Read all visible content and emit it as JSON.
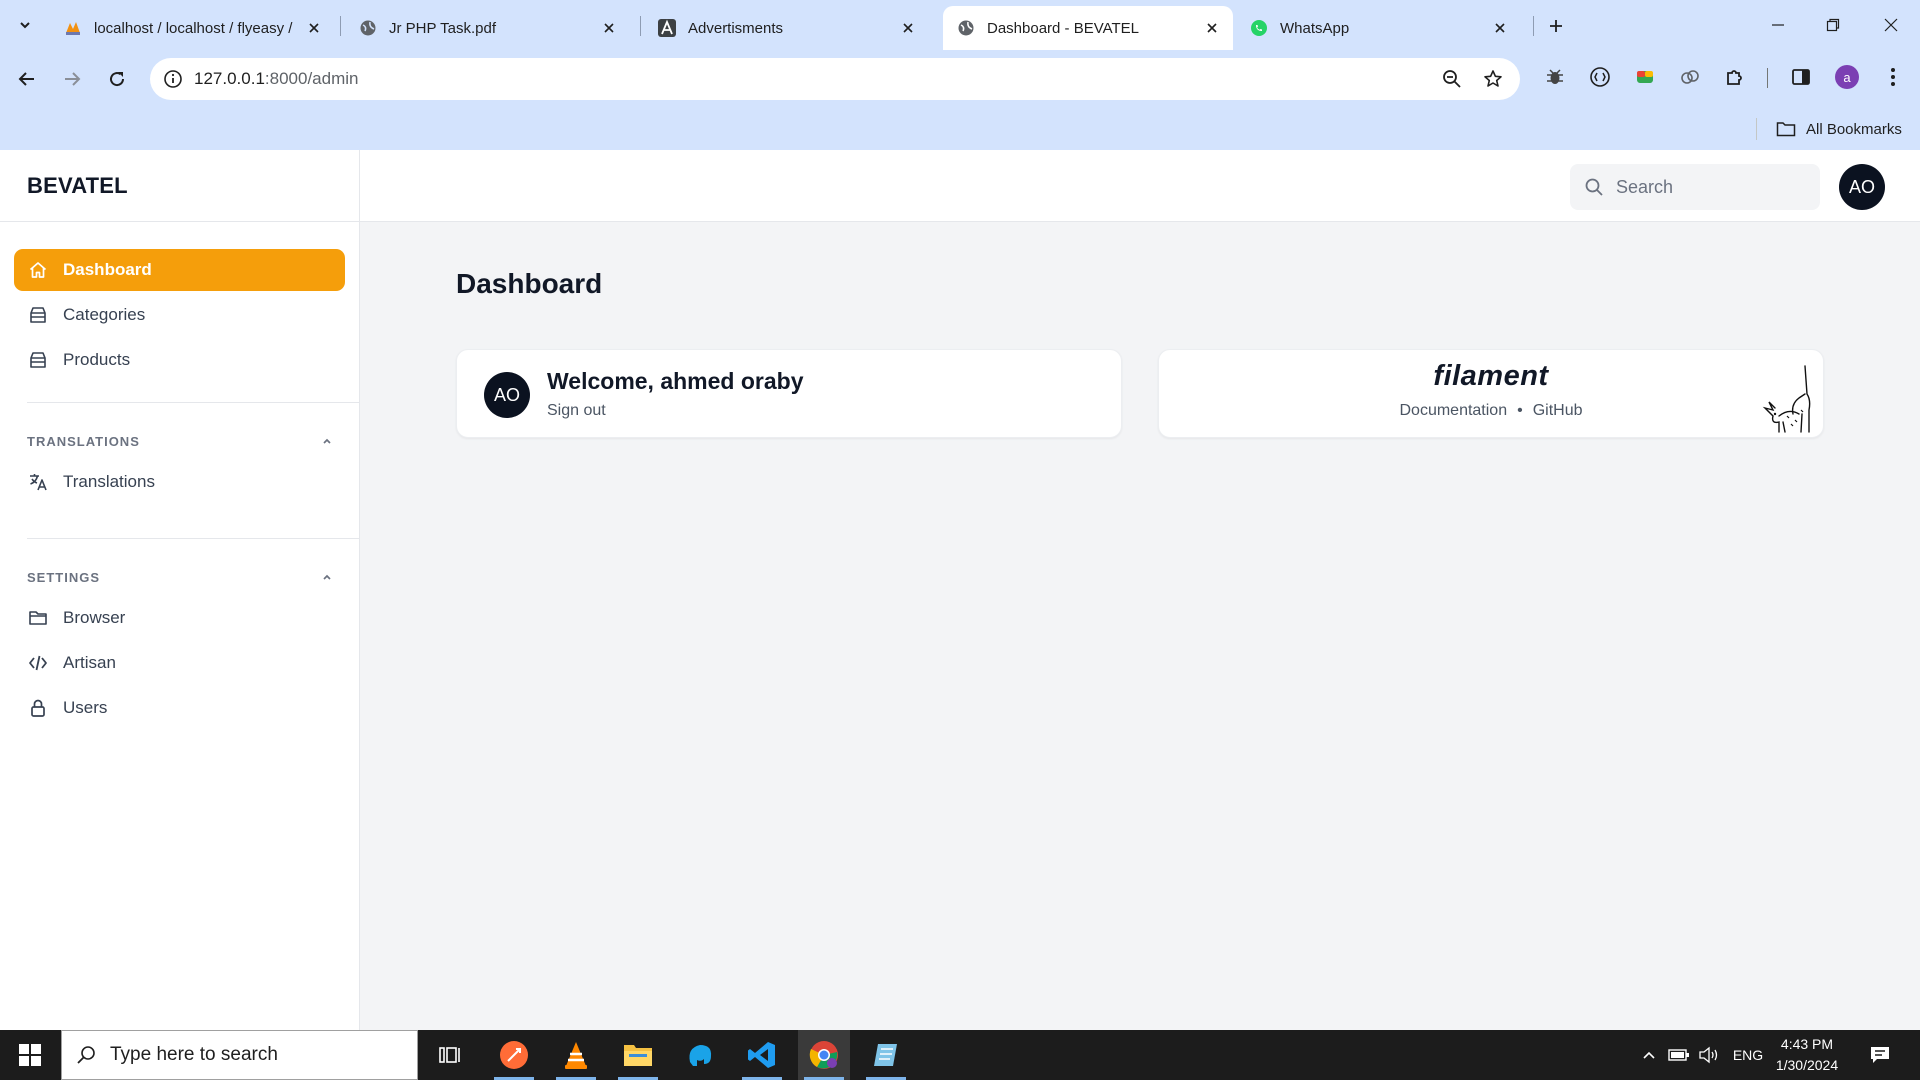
{
  "browser": {
    "tabs": [
      {
        "title": "localhost / localhost / flyeasy /",
        "active": false
      },
      {
        "title": "Jr PHP Task.pdf",
        "active": false
      },
      {
        "title": "Advertisments",
        "active": false
      },
      {
        "title": "Dashboard - BEVATEL",
        "active": true
      },
      {
        "title": "WhatsApp",
        "active": false
      }
    ],
    "url_host": "127.0.0.1",
    "url_path": ":8000/admin",
    "profile_initial": "a",
    "bookmarks_label": "All Bookmarks",
    "accent": "#d3e3fd"
  },
  "app": {
    "brand": "BEVATEL",
    "primary_color": "#f59e0b",
    "nav": {
      "dashboard": "Dashboard",
      "categories": "Categories",
      "products": "Products"
    },
    "groups": {
      "translations": {
        "label": "TRANSLATIONS",
        "items": [
          "Translations"
        ]
      },
      "settings": {
        "label": "SETTINGS",
        "items": [
          "Browser",
          "Artisan",
          "Users"
        ]
      }
    },
    "search_placeholder": "Search",
    "user_initials": "AO",
    "page_title": "Dashboard",
    "welcome": {
      "title": "Welcome, ahmed oraby",
      "sign_out": "Sign out",
      "initials": "AO"
    },
    "filament": {
      "logo": "filament",
      "documentation": "Documentation",
      "separator": "•",
      "github": "GitHub"
    }
  },
  "taskbar": {
    "search_placeholder": "Type here to search",
    "language": "ENG",
    "time": "4:43 PM",
    "date": "1/30/2024"
  }
}
